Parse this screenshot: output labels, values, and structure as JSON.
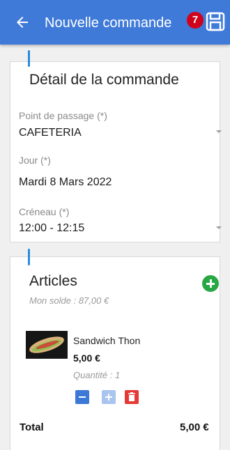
{
  "appbar": {
    "title": "Nouvelle commande",
    "badge_count": "7",
    "color": "#3f7ad9",
    "back_icon": "arrow-left-icon",
    "save_icon": "floppy-disk-icon"
  },
  "details": {
    "title": "Détail de la commande",
    "point_label": "Point de passage (*)",
    "point_value": "CAFETERIA",
    "day_label": "Jour (*)",
    "day_value": "Mardi 8 Mars 2022",
    "slot_label": "Créneau (*)",
    "slot_value": "12:00 - 12:15"
  },
  "articles": {
    "title": "Articles",
    "balance": "Mon solde : 87,00 €",
    "add_icon": "plus-circle-icon",
    "items": [
      {
        "name": "Sandwich Thon",
        "price": "5,00 €",
        "quantity": "Quantité : 1"
      }
    ],
    "total_label": "Total",
    "total_value": "5,00 €"
  },
  "colors": {
    "accent": "#2a8be0",
    "add": "#28a745",
    "minus": "#3b78d8",
    "plus_disabled": "#a9c4ee",
    "delete": "#e53935",
    "badge": "#d0021b"
  }
}
